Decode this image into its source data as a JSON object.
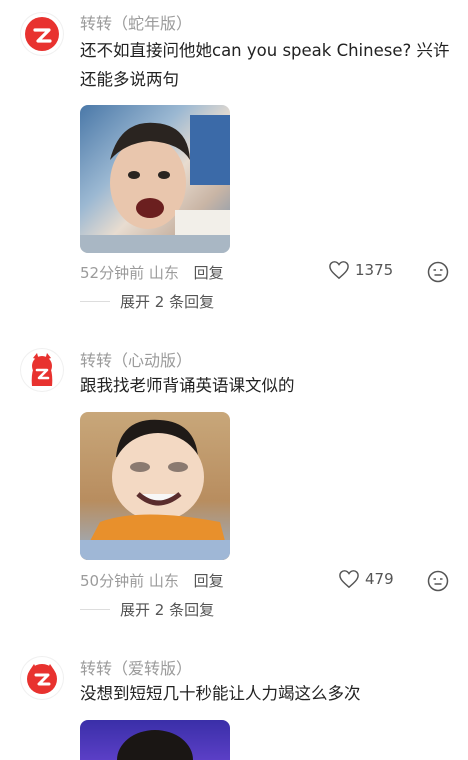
{
  "comments": [
    {
      "author": "转转（蛇年版）",
      "text": "还不如直接问他她can you speak Chinese? 兴许还能多说两句",
      "time": "52分钟前",
      "location": "山东",
      "reply_label": "回复",
      "likes": "1375",
      "expand": "展开 2 条回复"
    },
    {
      "author": "转转（心动版）",
      "text": "跟我找老师背诵英语课文似的",
      "time": "50分钟前",
      "location": "山东",
      "reply_label": "回复",
      "likes": "479",
      "expand": "展开 2 条回复"
    },
    {
      "author": "转转（爱转版）",
      "text": "没想到短短几十秒能让人力竭这么多次"
    }
  ]
}
